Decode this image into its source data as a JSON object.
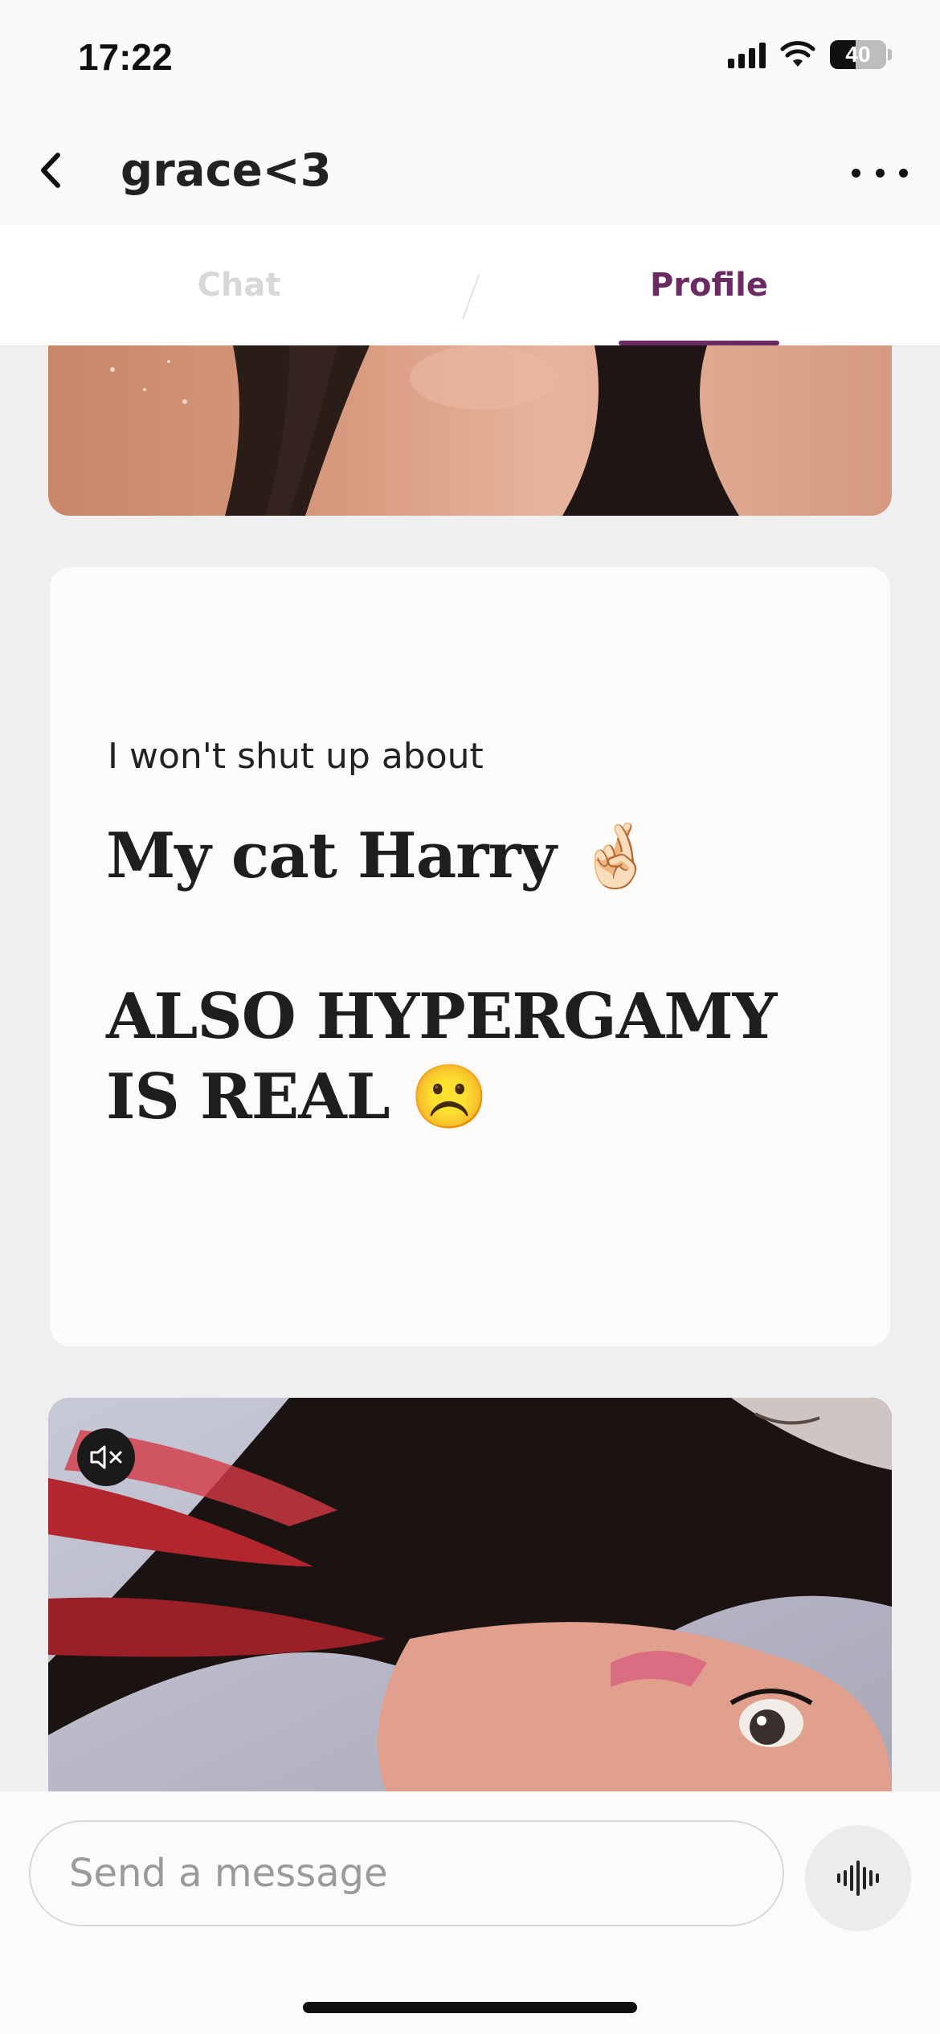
{
  "status_bar": {
    "time": "17:22",
    "battery": "40",
    "icons": [
      "signal-icon",
      "wifi-icon",
      "battery-icon"
    ]
  },
  "header": {
    "title": "grace<3",
    "back_icon": "chevron-left-icon",
    "more_icon": "ellipsis-icon"
  },
  "tabs": [
    {
      "label": "Chat",
      "active": false
    },
    {
      "label": "Profile",
      "active": true
    }
  ],
  "prompt": {
    "label": "I won't shut up about",
    "answer": "My cat Harry 🤞🏻\n\nALSO HYPERGAMY IS REAL ☹️"
  },
  "media": {
    "mute_icon": "speaker-muted-icon"
  },
  "composer": {
    "placeholder": "Send a message",
    "voice_icon": "waveform-icon"
  },
  "colors": {
    "accent": "#6a2b63",
    "background": "#efefef",
    "card": "#fcfbfa"
  }
}
